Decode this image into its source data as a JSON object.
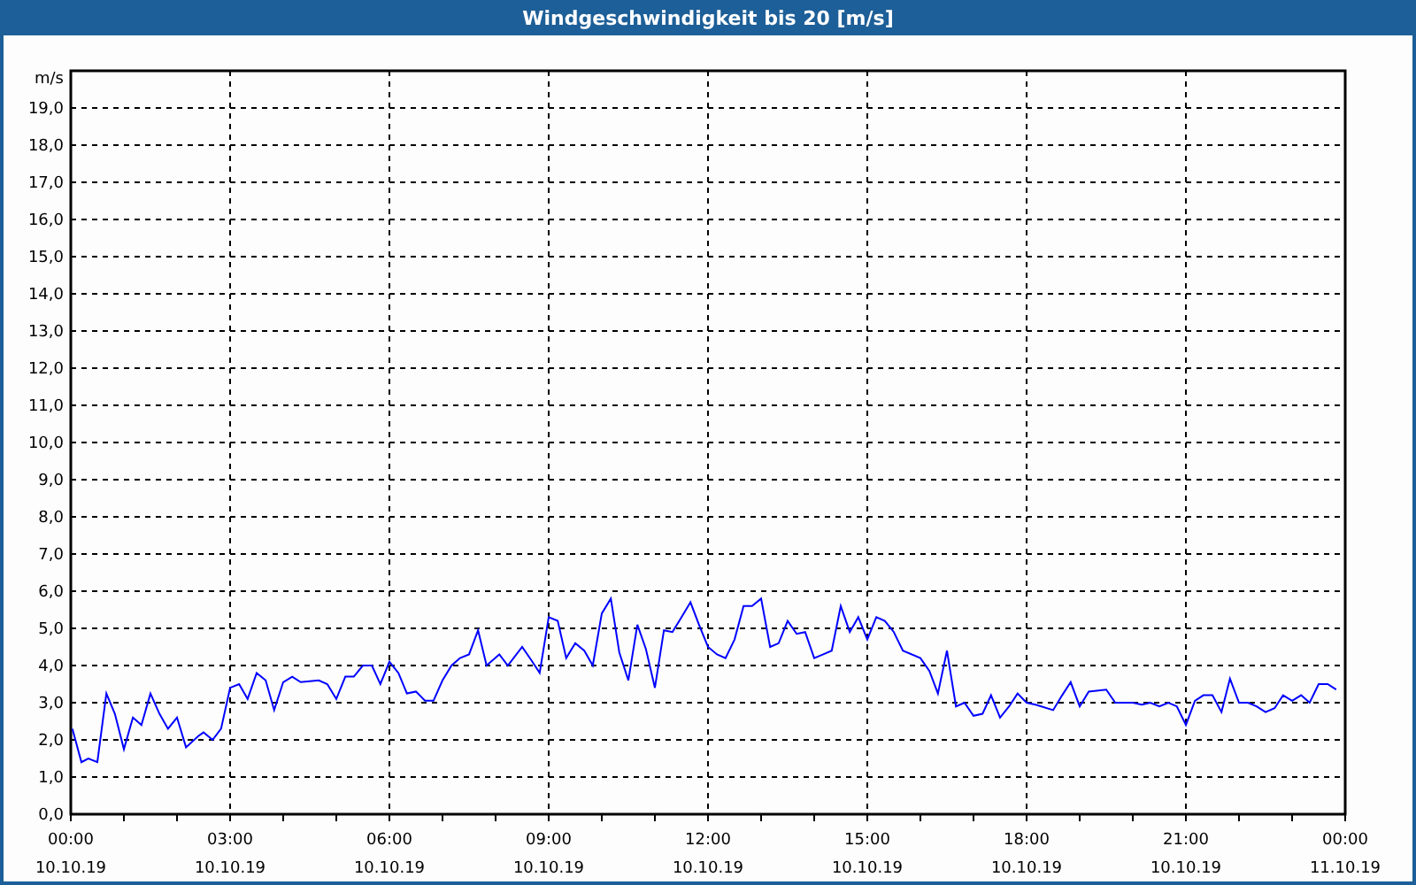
{
  "window": {
    "title": "Windgeschwindigkeit bis 20 [m/s]"
  },
  "chart": {
    "chart_data": {
      "type": "line",
      "ylabel": "m/s",
      "xlim": [
        0,
        24
      ],
      "ylim": [
        0,
        20
      ],
      "grid": true,
      "xticks": [
        {
          "value": 0,
          "label": "00:00"
        },
        {
          "value": 3,
          "label": "03:00"
        },
        {
          "value": 6,
          "label": "06:00"
        },
        {
          "value": 9,
          "label": "09:00"
        },
        {
          "value": 12,
          "label": "12:00"
        },
        {
          "value": 15,
          "label": "15:00"
        },
        {
          "value": 18,
          "label": "18:00"
        },
        {
          "value": 21,
          "label": "21:00"
        },
        {
          "value": 24,
          "label": "00:00"
        }
      ],
      "annotations": [
        "10.10.19",
        "10.10.19",
        "10.10.19",
        "10.10.19",
        "10.10.19",
        "10.10.19",
        "10.10.19",
        "10.10.19",
        "11.10.19"
      ],
      "yticks": [
        {
          "value": 0,
          "label": "0,0"
        },
        {
          "value": 1,
          "label": "1,0"
        },
        {
          "value": 2,
          "label": "2,0"
        },
        {
          "value": 3,
          "label": "3,0"
        },
        {
          "value": 4,
          "label": "4,0"
        },
        {
          "value": 5,
          "label": "5,0"
        },
        {
          "value": 6,
          "label": "6,0"
        },
        {
          "value": 7,
          "label": "7,0"
        },
        {
          "value": 8,
          "label": "8,0"
        },
        {
          "value": 9,
          "label": "9,0"
        },
        {
          "value": 10,
          "label": "10,0"
        },
        {
          "value": 11,
          "label": "11,0"
        },
        {
          "value": 12,
          "label": "12,0"
        },
        {
          "value": 13,
          "label": "13,0"
        },
        {
          "value": 14,
          "label": "14,0"
        },
        {
          "value": 15,
          "label": "15,0"
        },
        {
          "value": 16,
          "label": "16,0"
        },
        {
          "value": 17,
          "label": "17,0"
        },
        {
          "value": 18,
          "label": "18,0"
        },
        {
          "value": 19,
          "label": "19,0"
        }
      ],
      "x": [
        0.03,
        0.2,
        0.33,
        0.5,
        0.67,
        0.83,
        1,
        1.17,
        1.33,
        1.5,
        1.67,
        1.83,
        2,
        2.17,
        2.4,
        2.5,
        2.67,
        2.83,
        3,
        3.17,
        3.33,
        3.5,
        3.67,
        3.83,
        4,
        4.17,
        4.33,
        4.67,
        4.83,
        5,
        5.17,
        5.33,
        5.5,
        5.67,
        5.83,
        6,
        6.17,
        6.33,
        6.5,
        6.67,
        6.83,
        7,
        7.17,
        7.33,
        7.5,
        7.67,
        7.83,
        8.07,
        8.23,
        8.5,
        8.67,
        8.83,
        9,
        9.17,
        9.33,
        9.5,
        9.67,
        9.83,
        10,
        10.17,
        10.33,
        10.5,
        10.67,
        10.83,
        11,
        11.17,
        11.33,
        11.5,
        11.67,
        11.83,
        12,
        12.17,
        12.33,
        12.5,
        12.67,
        12.83,
        13,
        13.17,
        13.33,
        13.5,
        13.67,
        13.83,
        14,
        14.17,
        14.33,
        14.5,
        14.67,
        14.83,
        15,
        15.17,
        15.33,
        15.5,
        15.67,
        16,
        16.17,
        16.33,
        16.5,
        16.67,
        16.83,
        17,
        17.17,
        17.33,
        17.5,
        17.67,
        17.83,
        18,
        18.17,
        18.5,
        18.67,
        18.83,
        19,
        19.17,
        19.5,
        19.67,
        20,
        20.17,
        20.33,
        20.5,
        20.67,
        20.83,
        21,
        21.17,
        21.33,
        21.5,
        21.67,
        21.83,
        22,
        22.17,
        22.33,
        22.5,
        22.67,
        22.83,
        23,
        23.17,
        23.33,
        23.5,
        23.67,
        23.83
      ],
      "series": [
        {
          "color": "#0000ff",
          "values": [
            2.3,
            1.4,
            1.5,
            1.4,
            3.25,
            2.7,
            1.75,
            2.6,
            2.4,
            3.25,
            2.7,
            2.3,
            2.6,
            1.8,
            2.1,
            2.2,
            2.0,
            2.3,
            3.4,
            3.5,
            3.1,
            3.8,
            3.6,
            2.8,
            3.55,
            3.7,
            3.55,
            3.6,
            3.5,
            3.1,
            3.7,
            3.7,
            4.0,
            4.0,
            3.5,
            4.1,
            3.8,
            3.25,
            3.3,
            3.05,
            3.05,
            3.6,
            4.0,
            4.2,
            4.3,
            4.95,
            4.0,
            4.3,
            4.0,
            4.5,
            4.15,
            3.8,
            5.3,
            5.2,
            4.2,
            4.6,
            4.4,
            4.0,
            5.4,
            5.8,
            4.35,
            3.6,
            5.1,
            4.45,
            3.4,
            4.95,
            4.9,
            5.3,
            5.7,
            5.1,
            4.5,
            4.3,
            4.2,
            4.7,
            5.6,
            5.6,
            5.8,
            4.5,
            4.6,
            5.2,
            4.85,
            4.9,
            4.2,
            4.3,
            4.4,
            5.6,
            4.9,
            5.3,
            4.7,
            5.3,
            5.2,
            4.9,
            4.4,
            4.2,
            3.85,
            3.25,
            4.4,
            2.9,
            3.0,
            2.65,
            2.7,
            3.2,
            2.6,
            2.9,
            3.25,
            3.0,
            2.95,
            2.8,
            3.2,
            3.55,
            2.9,
            3.3,
            3.35,
            3.0,
            3.0,
            2.95,
            3.0,
            2.9,
            3.0,
            2.9,
            2.4,
            3.05,
            3.2,
            3.2,
            2.75,
            3.65,
            3.0,
            3.0,
            2.9,
            2.75,
            2.85,
            3.2,
            3.05,
            3.2,
            3.0,
            3.5,
            3.5,
            3.35
          ]
        }
      ]
    }
  }
}
